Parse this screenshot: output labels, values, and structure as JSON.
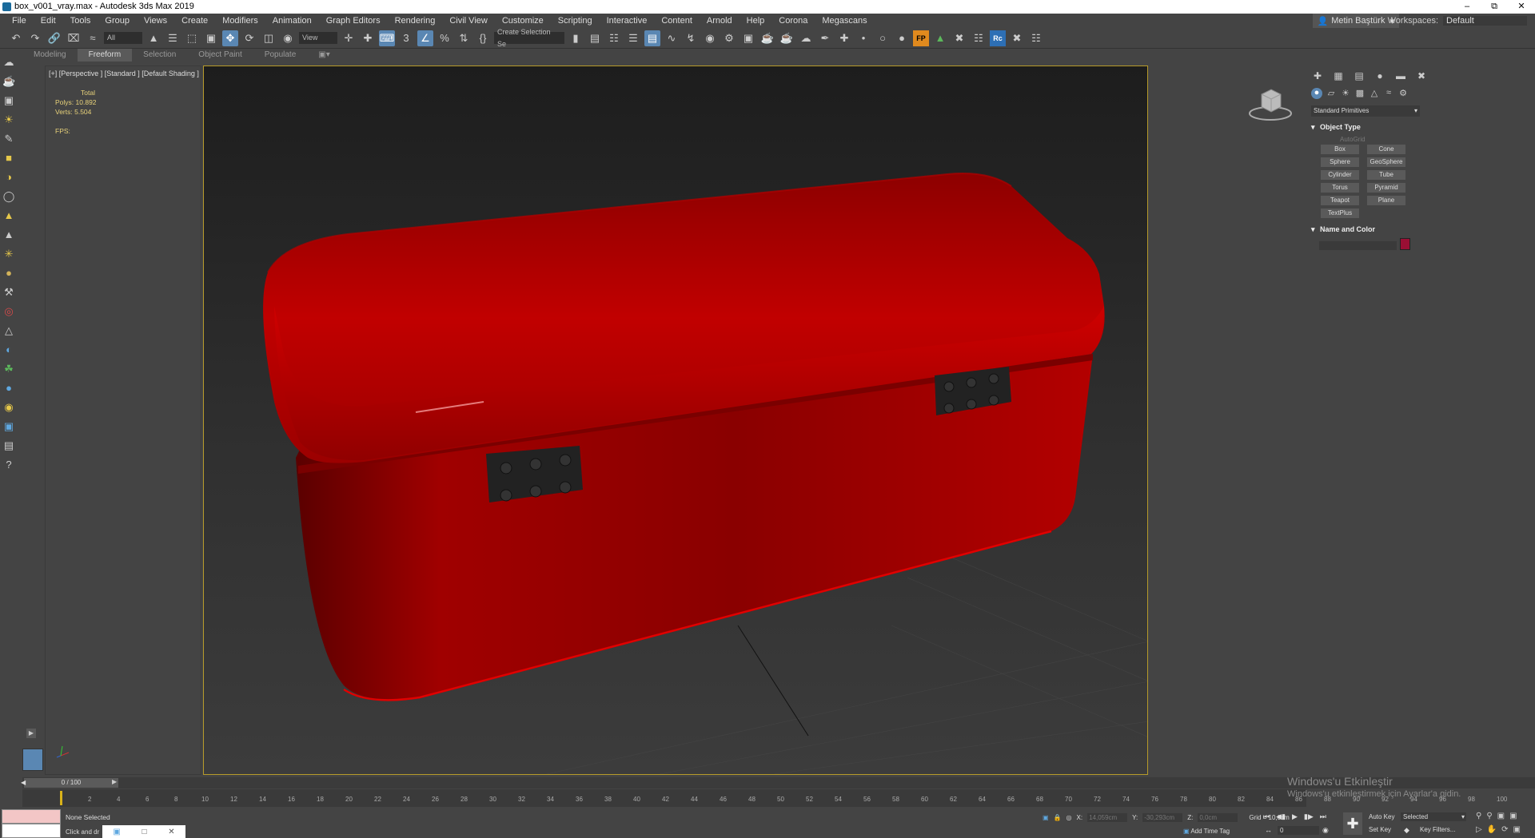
{
  "window": {
    "title": "box_v001_vray.max - Autodesk 3ds Max 2019"
  },
  "menu": [
    "File",
    "Edit",
    "Tools",
    "Group",
    "Views",
    "Create",
    "Modifiers",
    "Animation",
    "Graph Editors",
    "Rendering",
    "Civil View",
    "Customize",
    "Scripting",
    "Interactive",
    "Content",
    "Arnold",
    "Help",
    "Corona",
    "Megascans"
  ],
  "user": {
    "name": "Metin Baştürk"
  },
  "workspace": {
    "label": "Workspaces:",
    "value": "Default"
  },
  "toolbar": {
    "filter": "All",
    "refcoord": "View",
    "selset": "Create Selection Se"
  },
  "ribbon_tabs": [
    "Modeling",
    "Freeform",
    "Selection",
    "Object Paint",
    "Populate"
  ],
  "viewport": {
    "label": "[+] [Perspective ] [Standard ] [Default Shading ]",
    "stats": {
      "total": "Total",
      "polys_label": "Polys:",
      "polys": "10.892",
      "verts_label": "Verts:",
      "verts": "5.504",
      "fps_label": "FPS:"
    }
  },
  "command_panel": {
    "category": "Standard Primitives",
    "object_type_title": "Object Type",
    "autogrid": "AutoGrid",
    "buttons": [
      "Box",
      "Cone",
      "Sphere",
      "GeoSphere",
      "Cylinder",
      "Tube",
      "Torus",
      "Pyramid",
      "Teapot",
      "Plane",
      "TextPlus"
    ],
    "name_color_title": "Name and Color",
    "object_color": "#9a0f34"
  },
  "timeline": {
    "frame": "0 / 100",
    "ticks": [
      "2",
      "4",
      "6",
      "8",
      "10",
      "12",
      "14",
      "16",
      "18",
      "20",
      "22",
      "24",
      "26",
      "28",
      "30",
      "32",
      "34",
      "36",
      "38",
      "40",
      "42",
      "44",
      "46",
      "48",
      "50",
      "52",
      "54",
      "56",
      "58",
      "60",
      "62",
      "64",
      "66",
      "68",
      "70",
      "72",
      "74",
      "76",
      "78",
      "80",
      "82",
      "84",
      "86",
      "88",
      "90",
      "92",
      "94",
      "96",
      "98",
      "100"
    ]
  },
  "status": {
    "selection": "None Selected",
    "prompt": "Click and dr",
    "x_label": "X:",
    "x": "14,059cm",
    "y_label": "Y:",
    "y": "-30,293cm",
    "z_label": "Z:",
    "z": "0,0cm",
    "grid": "Grid = 10,0cm",
    "add_time_tag": "Add Time Tag",
    "auto_key": "Auto Key",
    "key_mode": "Selected",
    "set_key": "Set Key",
    "key_filters": "Key Filters...",
    "current_frame": "0"
  },
  "activation": {
    "line1": "Windows'u Etkinleştir",
    "line2": "Windows'u etkinleştirmek için Ayarlar'a gidin."
  },
  "colors": {
    "accent": "#5a87b3",
    "viewport_border": "#b69a2a",
    "box_red": "#c40000"
  }
}
